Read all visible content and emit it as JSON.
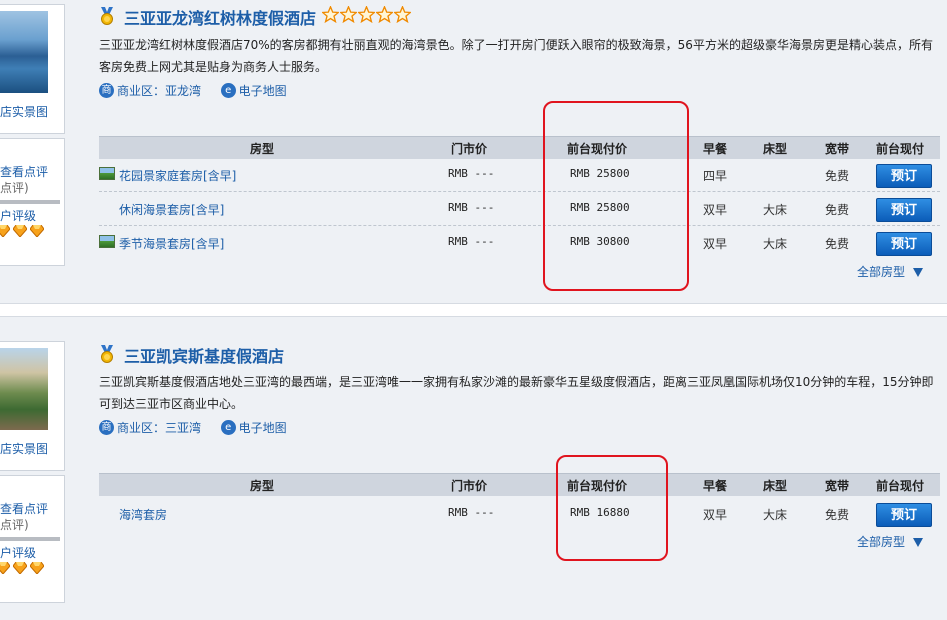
{
  "columns": {
    "room": "房型",
    "rack": "门市价",
    "front_desk": "前台现付价",
    "breakfast": "早餐",
    "bed": "床型",
    "broadband": "宽带",
    "pay_book": "前台现付"
  },
  "sidebar": {
    "photo_link": "店实景图",
    "review_link": "查看点评",
    "review_count": "点评)",
    "rating_link": "户评级"
  },
  "hotels": [
    {
      "name": "三亚亚龙湾红树林度假酒店",
      "stars": 5,
      "description": "三亚亚龙湾红树林度假酒店70%的客房都拥有壮丽直观的海湾景色。除了一打开房门便跃入眼帘的极致海景，56平方米的超级豪华海景房更是精心装点，所有客房免费上网尤其是贴身为商务人士服务。",
      "district_label": "商业区：亚龙湾",
      "map_label": "电子地图",
      "rooms": [
        {
          "name": "花园景家庭套房[含早]",
          "rack": "RMB ---",
          "price": "RMB 25800",
          "breakfast": "四早",
          "bed": "",
          "broadband": "免费",
          "button": "预订"
        },
        {
          "name": "休闲海景套房[含早]",
          "rack": "RMB ---",
          "price": "RMB 25800",
          "breakfast": "双早",
          "bed": "大床",
          "broadband": "免费",
          "button": "预订"
        },
        {
          "name": "季节海景套房[含早]",
          "rack": "RMB ---",
          "price": "RMB 30800",
          "breakfast": "双早",
          "bed": "大床",
          "broadband": "免费",
          "button": "预订"
        }
      ],
      "all_types": "全部房型"
    },
    {
      "name": "三亚凯宾斯基度假酒店",
      "stars": 0,
      "description": "三亚凯宾斯基度假酒店地处三亚湾的最西端，是三亚湾唯一一家拥有私家沙滩的最新豪华五星级度假酒店，距离三亚凤凰国际机场仅10分钟的车程，15分钟即可到达三亚市区商业中心。",
      "district_label": "商业区：三亚湾",
      "map_label": "电子地图",
      "rooms": [
        {
          "name": "海湾套房",
          "rack": "RMB ---",
          "price": "RMB 16880",
          "breakfast": "双早",
          "bed": "大床",
          "broadband": "免费",
          "button": "预订"
        }
      ],
      "all_types": "全部房型"
    }
  ],
  "icons": {
    "medal": "medal-icon",
    "star": "star-outline-icon",
    "district": "district-icon",
    "map": "e-map-icon",
    "room_photo": "room-photo-icon",
    "gem": "rating-gem-icon",
    "triangle": "triangle-down-icon"
  },
  "colors": {
    "link": "#1d5ea8",
    "button": "#0b5cb8",
    "highlight": "#e0141e",
    "header_bg": "#cfd5de"
  }
}
